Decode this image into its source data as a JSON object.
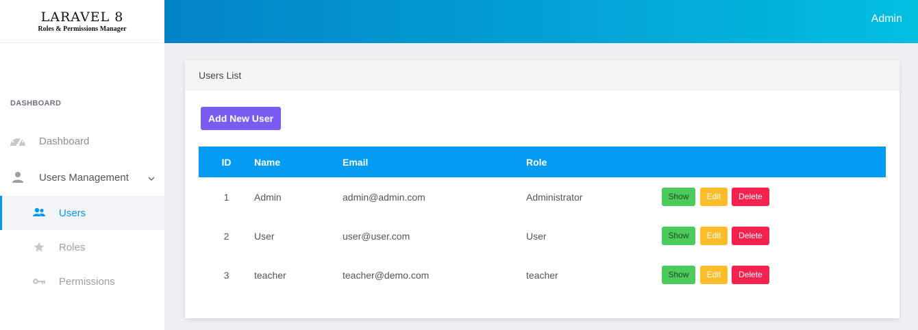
{
  "brand": {
    "title": "LARAVEL 8",
    "subtitle": "Roles & Permissions Manager"
  },
  "header": {
    "user": "Admin"
  },
  "sidebar": {
    "section": "DASHBOARD",
    "items": [
      {
        "label": "Dashboard",
        "icon": "speedometer-icon"
      },
      {
        "label": "Users Management",
        "icon": "user-icon"
      },
      {
        "label": "Users",
        "icon": "users-icon",
        "active": true
      },
      {
        "label": "Roles",
        "icon": "star-icon"
      },
      {
        "label": "Permissions",
        "icon": "key-icon"
      }
    ]
  },
  "card": {
    "title": "Users List",
    "add_button": "Add New User"
  },
  "table": {
    "columns": [
      "ID",
      "Name",
      "Email",
      "Role"
    ],
    "rows": [
      {
        "id": "1",
        "name": "Admin",
        "email": "admin@admin.com",
        "role": "Administrator"
      },
      {
        "id": "2",
        "name": "User",
        "email": "user@user.com",
        "role": "User"
      },
      {
        "id": "3",
        "name": "teacher",
        "email": "teacher@demo.com",
        "role": "teacher"
      }
    ],
    "actions": {
      "show": "Show",
      "edit": "Edit",
      "delete": "Delete"
    }
  },
  "colors": {
    "accent": "#049cf2",
    "add_button": "#7b5cf0",
    "show": "#4ccb5d",
    "edit": "#fbbd2a",
    "delete": "#f5214f"
  }
}
